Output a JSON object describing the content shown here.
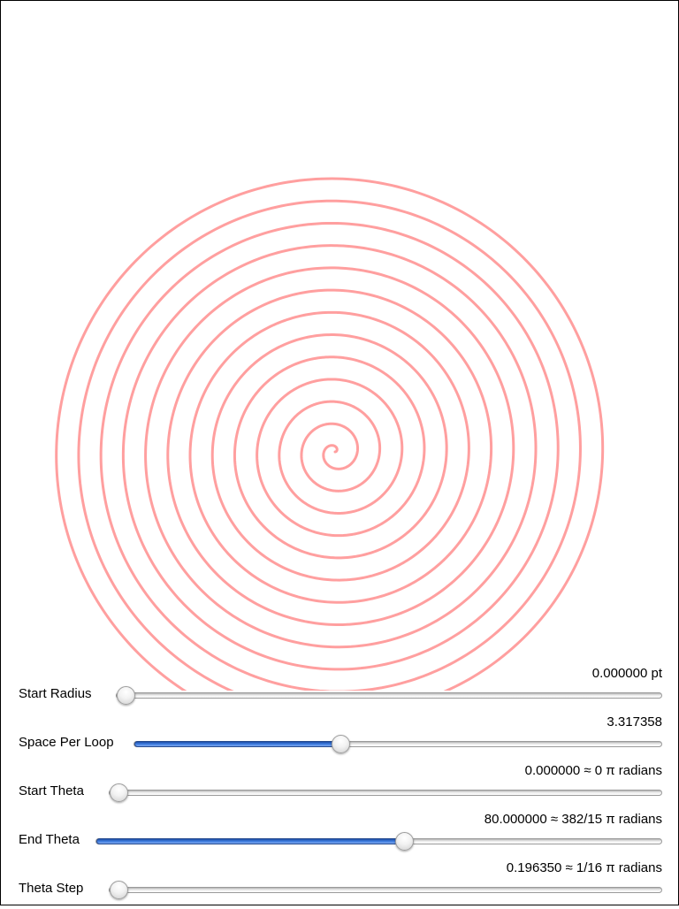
{
  "spiral": {
    "color": "#ff9f9f",
    "start_radius_pt": 0.0,
    "space_per_loop": 3.317358,
    "start_theta": 0.0,
    "end_theta": 80.0,
    "theta_step": 0.19635
  },
  "sliders": [
    {
      "id": "start-radius",
      "label": "Start Radius",
      "value_text": "0.000000 pt",
      "fraction": 0.0,
      "fill": false
    },
    {
      "id": "space-per-loop",
      "label": "Space Per Loop",
      "value_text": "3.317358",
      "fraction": 0.38,
      "fill": true
    },
    {
      "id": "start-theta",
      "label": "Start Theta",
      "value_text": "0.000000 ≈ 0 π radians",
      "fraction": 0.0,
      "fill": false
    },
    {
      "id": "end-theta",
      "label": "End Theta",
      "value_text": "80.000000 ≈ 382/15 π radians",
      "fraction": 0.535,
      "fill": true
    },
    {
      "id": "theta-step",
      "label": "Theta Step",
      "value_text": "0.196350 ≈ 1/16 π radians",
      "fraction": 0.0,
      "fill": false
    }
  ],
  "colors": {
    "accent": "#3f7de0",
    "spiral": "#ff9f9f",
    "frame": "#000000"
  }
}
